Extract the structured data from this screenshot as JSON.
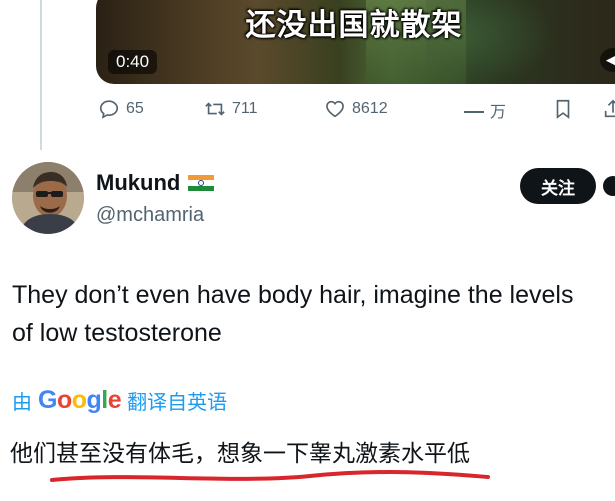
{
  "video": {
    "caption": "还没出国就散架",
    "time": "0:40"
  },
  "actions": {
    "replies": "65",
    "retweets": "711",
    "likes": "8612",
    "views": "万"
  },
  "tweet": {
    "author_name": "Mukund",
    "handle": "@mchamria",
    "follow_label": "关注",
    "text_line1": "They don’t even have body hair, imagine the levels",
    "text_line2": "of low testosterone",
    "translate_prefix": "由",
    "translate_brand": "Google",
    "translate_suffix": "翻译自英语",
    "translated_text": "他们甚至没有体毛，想象一下睾丸激素水平低"
  },
  "icons": [
    "reply-icon",
    "retweet-icon",
    "like-icon",
    "views-icon",
    "bookmark-icon",
    "share-icon",
    "volume-icon",
    "india-flag-icon",
    "more-icon"
  ],
  "colors": {
    "text": "#0f1419",
    "secondary": "#536471",
    "link": "#1d9bf0",
    "underline_annotation": "#d8262c"
  }
}
